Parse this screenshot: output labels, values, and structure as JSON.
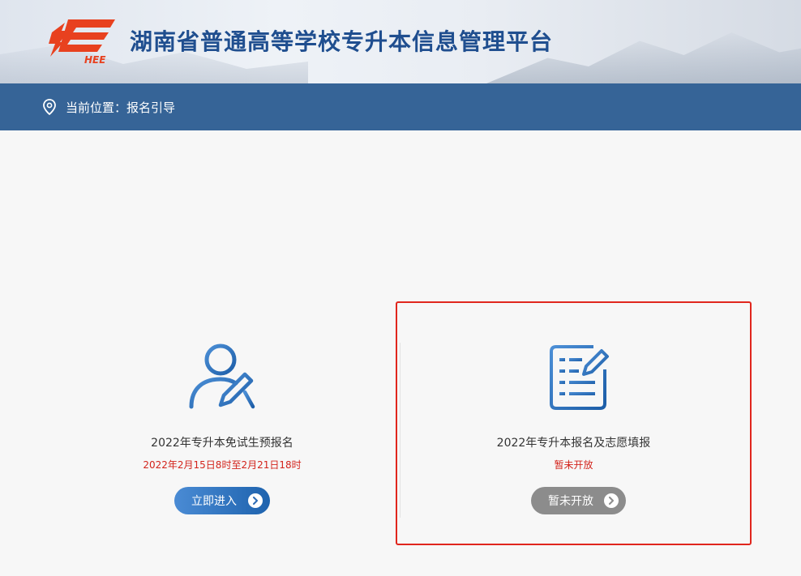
{
  "header": {
    "site_title": "湖南省普通高等学校专升本信息管理平台",
    "logo_text": "HEE"
  },
  "location": {
    "prefix": "当前位置：",
    "current": "报名引导"
  },
  "cards": [
    {
      "title": "2022年专升本免试生预报名",
      "subtitle": "2022年2月15日8时至2月21日18时",
      "button_label": "立即进入",
      "button_state": "enabled",
      "icon": "user-edit-icon"
    },
    {
      "title": "2022年专升本报名及志愿填报",
      "subtitle": "暂未开放",
      "button_label": "暂未开放",
      "button_state": "disabled",
      "icon": "form-edit-icon"
    }
  ],
  "colors": {
    "brand_blue": "#1f4e8f",
    "location_bar": "#366497",
    "highlight_red": "#e0261d",
    "notice_red": "#d3241c"
  }
}
